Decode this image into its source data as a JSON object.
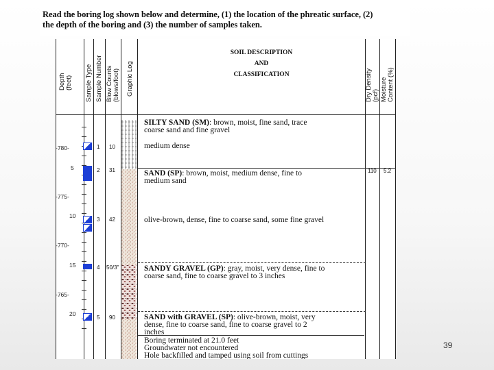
{
  "question": {
    "line1": "Read the boring log shown below and determine, (1) the location of the phreatic surface, (2)",
    "line2": "the depth of the boring and (3) the number of samples taken."
  },
  "headers": {
    "depth": "Depth\n(feet)",
    "sample_type": "Sample Type",
    "sample_number": "Sample Number",
    "blow_counts": "Blow Counts\n(blows/foot)",
    "graphic_log": "Graphic Log",
    "soil_desc_1": "SOIL DESCRIPTION",
    "soil_desc_2": "AND",
    "soil_desc_3": "CLASSIFICATION",
    "dry_density": "Dry Density\n(pcf)",
    "moisture": "Moisture\nContent (%)"
  },
  "depth_labels": [
    "5",
    "10",
    "15",
    "20"
  ],
  "elevation_labels": [
    "-780-",
    "-775-",
    "-770-",
    "-765-"
  ],
  "samples": [
    {
      "number": "1",
      "blows": "10"
    },
    {
      "number": "2",
      "blows": "31"
    },
    {
      "number": "3",
      "blows": "42"
    },
    {
      "number": "4",
      "blows": "50/3\""
    },
    {
      "number": "5",
      "blows": "90"
    }
  ],
  "descriptions": {
    "silty_sand_bold": "SILTY SAND (SM)",
    "silty_sand_rest": ": brown, moist, fine sand, trace",
    "silty_sand_line2": "coarse sand and fine gravel",
    "medium_dense": "medium dense",
    "sand_sp_bold": "SAND (SP)",
    "sand_sp_rest": ": brown, moist, medium dense, fine to",
    "sand_sp_line2": "medium sand",
    "olive_brown": "olive-brown, dense, fine to coarse sand, some fine gravel",
    "gravel_bold": "SANDY GRAVEL (GP)",
    "gravel_rest": ": gray, moist, very dense, fine to",
    "gravel_line2": "coarse sand, fine to coarse gravel to 3 inches",
    "sand_gravel_bold": "SAND with GRAVEL (SP)",
    "sand_gravel_rest": ": olive-brown, moist, very",
    "sand_gravel_line2": "dense, fine to coarse sand, fine to coarse gravel to 2",
    "sand_gravel_line3": "inches",
    "note1": "Boring terminated at 21.0 feet",
    "note2": "Groundwater not encountered",
    "note3": "Hole backfilled and tamped using soil from cuttings"
  },
  "lab": {
    "dry_density": "110",
    "moisture": "5.2"
  },
  "page_number": "39"
}
